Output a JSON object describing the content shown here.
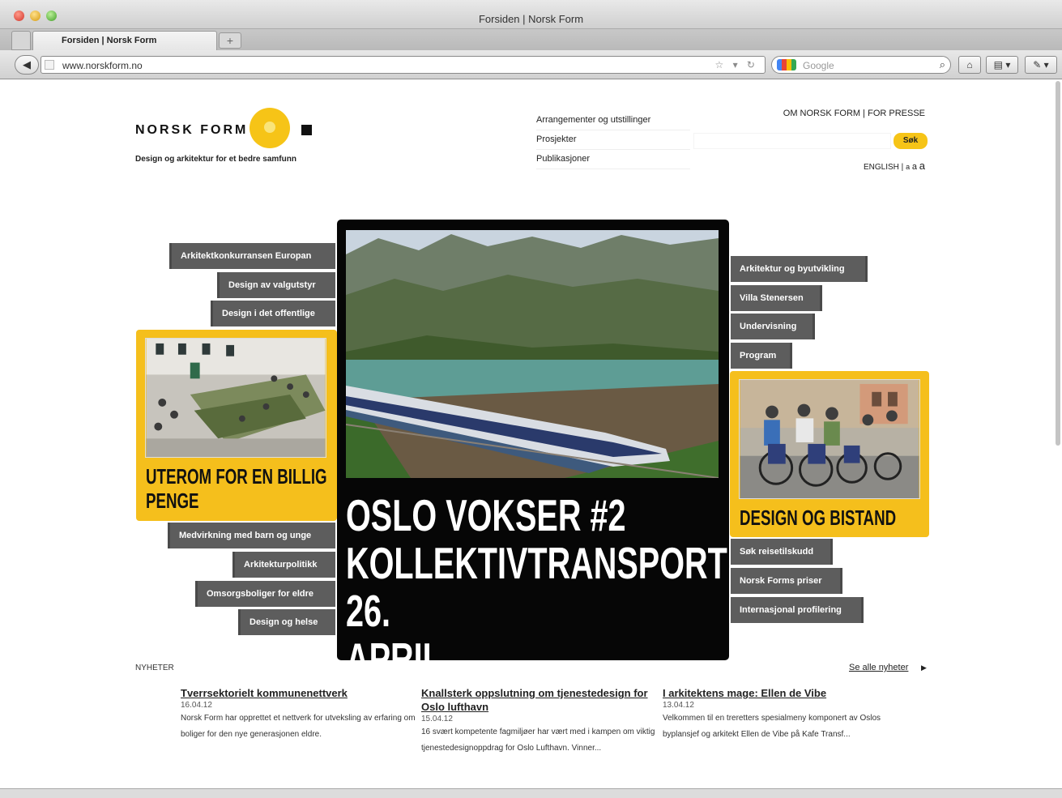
{
  "browser": {
    "window_title": "Forsiden | Norsk Form",
    "tab_title": "Forsiden | Norsk Form",
    "new_tab": "+",
    "url": "www.norskform.no",
    "search_placeholder": "Google"
  },
  "site": {
    "logo_text": "NORSK FORM",
    "tagline": "Design og arkitektur for et bedre samfunn",
    "top_nav": [
      "Arrangementer og utstillinger",
      "Prosjekter",
      "Publikasjoner"
    ],
    "top_links": {
      "about": "OM NORSK FORM",
      "separator": "|",
      "press": "FOR PRESSE"
    },
    "search_button": "Søk",
    "language": {
      "english": "ENGLISH",
      "separator": "|",
      "sizes": [
        "a",
        "a",
        "a"
      ]
    }
  },
  "left_tags_top": [
    "Arkitektkonkurransen Europan",
    "Design av valgutstyr",
    "Design i det offentlige"
  ],
  "left_feature": {
    "title_line1": "UTEROM FOR EN BILLIG",
    "title_line2": "PENGE"
  },
  "left_tags_bottom": [
    "Medvirkning med barn og unge",
    "Arkitekturpolitikk",
    "Omsorgsboliger for eldre",
    "Design og helse"
  ],
  "hero": {
    "title_line1": "OSLO VOKSER #2",
    "title_line2": "KOLLEKTIVTRANSPORT 26.",
    "title_line3": "APRIL"
  },
  "right_tags_top": [
    "Arkitektur og byutvikling",
    "Villa Stenersen",
    "Undervisning",
    "Program"
  ],
  "right_feature": {
    "title": "DESIGN OG BISTAND"
  },
  "right_tags_bottom": [
    "Søk reisetilskudd",
    "Norsk Forms priser",
    "Internasjonal profilering"
  ],
  "news": {
    "label": "NYHETER",
    "see_all": "Se alle nyheter",
    "see_all_arrow": "▶",
    "items": [
      {
        "title": "Tverrsektorielt kommunenettverk",
        "date": "16.04.12",
        "body": "Norsk Form har opprettet et nettverk for utveksling av erfaring om boliger for den nye generasjonen eldre."
      },
      {
        "title": "Knallsterk oppslutning om tjenestedesign for Oslo lufthavn",
        "date": "15.04.12",
        "body": "16 svært kompetente fagmiljøer har vært med i kampen om viktig tjenestedesignoppdrag for Oslo Lufthavn. Vinner..."
      },
      {
        "title": "I arkitektens mage: Ellen de Vibe",
        "date": "13.04.12",
        "body": "Velkommen til en treretters spesialmeny komponert av Oslos byplansjef og arkitekt Ellen de Vibe på Kafe Transf..."
      }
    ]
  },
  "colors": {
    "accent": "#f6c417",
    "tag_bg": "#5d5d5d",
    "hero_bg": "#060606"
  }
}
